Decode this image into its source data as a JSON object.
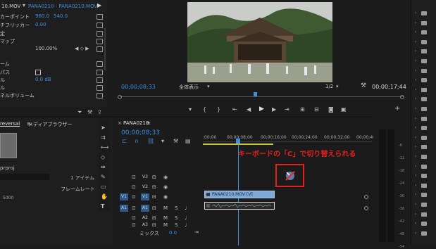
{
  "effect_controls": {
    "source_tab": "10.MOV",
    "sequence_tab": "PANA0210 - PANA0210.MOV",
    "rows": [
      {
        "label": "カーポイント",
        "v1": "960.0",
        "v2": "540.0"
      },
      {
        "label": "チフリッカー",
        "v1": "0.00",
        "v2": ""
      },
      {
        "label": "定",
        "v1": "",
        "v2": ""
      },
      {
        "label": "マップ",
        "v1": "",
        "v2": ""
      },
      {
        "label": "",
        "v1": "100.00%",
        "v2": ""
      },
      {
        "label": "ーム",
        "v1": "",
        "v2": ""
      },
      {
        "label": "パス",
        "v1": "",
        "v2": ""
      },
      {
        "label": "ル",
        "v1": "0.0 dB",
        "v2": ""
      },
      {
        "label": "ル",
        "v1": "",
        "v2": ""
      },
      {
        "label": "ネルボリューム",
        "v1": "",
        "v2": ""
      }
    ]
  },
  "program_monitor": {
    "timecode_current": "00;00;08;33",
    "zoom": "全体表示",
    "resolution": "1/2",
    "timecode_duration": "00;00;17;44"
  },
  "project_panel": {
    "tab_project": "reversal",
    "tab_browser": "メディアブラウザー",
    "file_name": "prproj",
    "item_count": "1 アイテム",
    "col_framerate": "フレームレート",
    "framerate_value": "5000"
  },
  "timeline": {
    "sequence_name": "PANA0210",
    "timecode": "00;00;08;33",
    "ruler_labels": [
      ":00;00",
      "00;00;08;00",
      "00;00;16;00",
      "00;00;24;00",
      "00;00;32;00",
      "00;00;40;00"
    ],
    "tracks": [
      {
        "name": "V3",
        "source": "",
        "kind": "video"
      },
      {
        "name": "V2",
        "source": "",
        "kind": "video"
      },
      {
        "name": "V1",
        "source": "V1",
        "kind": "video"
      },
      {
        "name": "A1",
        "source": "A1",
        "kind": "audio"
      },
      {
        "name": "A2",
        "source": "",
        "kind": "audio"
      },
      {
        "name": "A3",
        "source": "",
        "kind": "audio"
      }
    ],
    "mix_label": "ミックス",
    "mix_value": "0.0",
    "clip_label": "PANA0210.MOV [V]",
    "annotation": "キーボードの「C」で切り替えられる"
  },
  "audio_meter": {
    "scale": [
      "-6",
      "-12",
      "-18",
      "-24",
      "-30",
      "-36",
      "-42",
      "-48",
      "-54"
    ]
  },
  "colors": {
    "accent": "#3d8fe0",
    "annotation_red": "#e4201e",
    "clip_video": "#7da7d6",
    "playhead": "#3d8fe0"
  }
}
